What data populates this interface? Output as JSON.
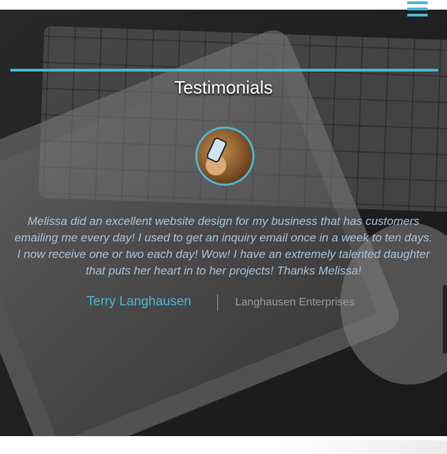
{
  "header": {
    "menu_icon": "hamburger-menu-icon"
  },
  "section": {
    "title": "Testimonials",
    "accent_color": "#4ab6d8"
  },
  "testimonial": {
    "quote": "Melissa did an excellent website design for my business that has customers emailing me every day! I used to get an inquiry email once in a week to ten days. I now receive one or two each day! Wow! I have an extremely talented daughter that puts her heart in to her projects! Thanks Melissa!",
    "author": "Terry Langhausen",
    "company": "Langhausen Enterprises"
  }
}
